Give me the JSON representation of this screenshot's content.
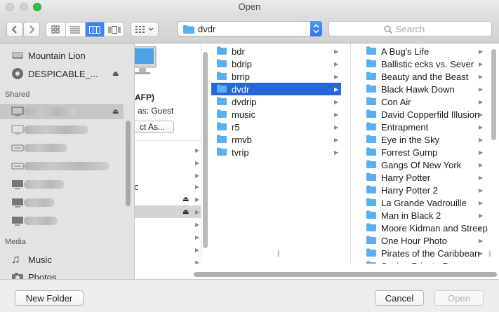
{
  "window": {
    "title": "Open"
  },
  "toolbar": {
    "path_value": "dvdr",
    "search_placeholder": "Search",
    "view_modes": [
      "icon-view",
      "list-view",
      "column-view",
      "coverflow-view"
    ],
    "active_view": "column-view"
  },
  "sidebar": {
    "devices": [
      {
        "label": "Mountain Lion",
        "icon": "hard-drive-icon",
        "eject": false
      },
      {
        "label": "DESPICABLE_...",
        "icon": "disc-icon",
        "eject": true
      }
    ],
    "shared_header": "Shared",
    "shared_count": 7,
    "media_header": "Media",
    "media": [
      {
        "label": "Music",
        "icon": "music-note-icon"
      },
      {
        "label": "Photos",
        "icon": "camera-icon"
      }
    ]
  },
  "column1": {
    "server_label": "(AFP)",
    "connected_as": "as: Guest",
    "connect_as_button": "ct As...",
    "partial_item": "ic"
  },
  "column2": {
    "items": [
      "bdr",
      "bdrip",
      "brrip",
      "dvdr",
      "dvdrip",
      "music",
      "r5",
      "rmvb",
      "tvrip"
    ],
    "selected": "dvdr"
  },
  "column3": {
    "items": [
      "A Bug's Life",
      "Ballistic ecks vs. Sever",
      "Beauty and the Beast",
      "Black Hawk Down",
      "Con Air",
      "David Copperfild Illusion",
      "Entrapment",
      "Eye in the Sky",
      "Forrest Gump",
      "Gangs Of New York",
      "Harry Potter",
      "Harry Potter 2",
      "La Grande Vadrouille",
      "Man in Black 2",
      "Moore Kidman and Streep",
      "One Hour Photo",
      "Pirates of the Caribbean",
      "Saving Private Ryan"
    ]
  },
  "footer": {
    "new_folder": "New Folder",
    "cancel": "Cancel",
    "open": "Open"
  },
  "colors": {
    "selection": "#2667dc",
    "folder_blue": "#5ab0ef",
    "close_zoom_green": "#2fc043"
  }
}
